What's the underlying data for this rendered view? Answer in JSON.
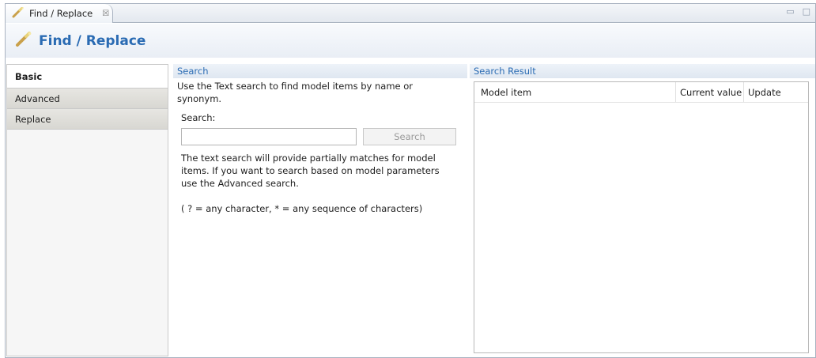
{
  "tab": {
    "title": "Find / Replace",
    "close_glyph": "☒"
  },
  "window_controls": {
    "minimize_glyph": "▭",
    "maximize_glyph": "□"
  },
  "form": {
    "title": "Find / Replace"
  },
  "nav": {
    "items": [
      {
        "label": "Basic",
        "active": true
      },
      {
        "label": "Advanced",
        "active": false
      },
      {
        "label": "Replace",
        "active": false
      }
    ]
  },
  "search_section": {
    "title": "Search",
    "description": "Use the Text search to find model items by name or synonym.",
    "label": "Search:",
    "input_value": "",
    "button_label": "Search",
    "help_text": "The text search will provide partially matches for model items. If you want to search based on model parameters use the Advanced search.",
    "wildcard_text": "( ? = any character, * = any sequence of characters)"
  },
  "result_section": {
    "title": "Search Result",
    "columns": [
      "Model item",
      "Current value",
      "Update"
    ]
  },
  "icons": {
    "tab_icon": "wand-icon",
    "header_icon": "wand-icon"
  },
  "colors": {
    "accent": "#2a6bb3",
    "border": "#a9b3c1"
  }
}
